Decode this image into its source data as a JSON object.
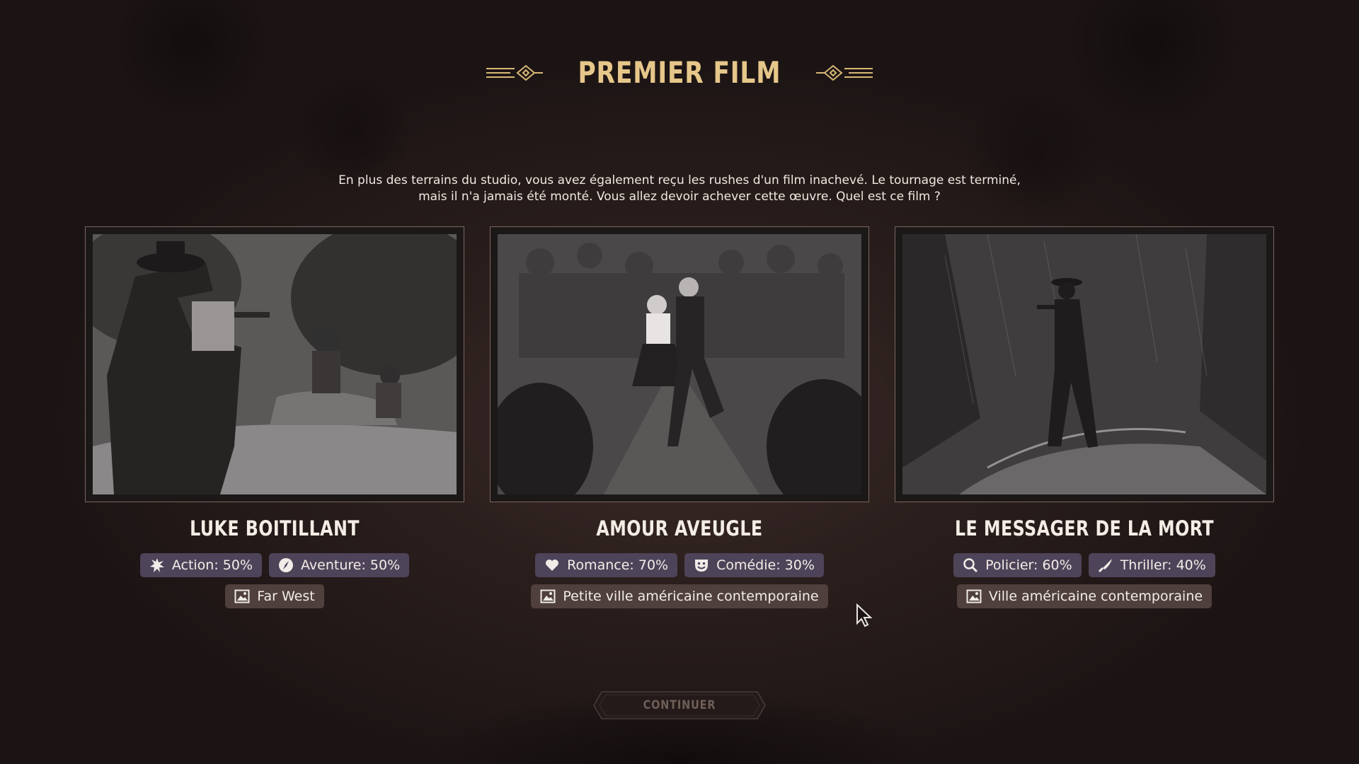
{
  "screen": {
    "title": "PREMIER FILM",
    "intro_line1": "En plus des terrains du studio, vous avez également reçu les rushes d'un film inachevé. Le tournage est terminé,",
    "intro_line2": "mais il n'a jamais été monté. Vous allez devoir achever cette œuvre. Quel est ce film ?"
  },
  "films": [
    {
      "title": "LUKE BOITILLANT",
      "genres": [
        {
          "label": "Action: 50%",
          "icon": "explosion-icon"
        },
        {
          "label": "Aventure: 50%",
          "icon": "compass-icon"
        }
      ],
      "setting": {
        "label": "Far West",
        "icon": "picture-icon"
      }
    },
    {
      "title": "AMOUR AVEUGLE",
      "genres": [
        {
          "label": "Romance: 70%",
          "icon": "heart-icon"
        },
        {
          "label": "Comédie: 30%",
          "icon": "mask-icon"
        }
      ],
      "setting": {
        "label": "Petite ville américaine contemporaine",
        "icon": "picture-icon"
      }
    },
    {
      "title": "LE MESSAGER DE LA MORT",
      "genres": [
        {
          "label": "Policier: 60%",
          "icon": "magnifier-icon"
        },
        {
          "label": "Thriller: 40%",
          "icon": "knife-icon"
        }
      ],
      "setting": {
        "label": "Ville américaine contemporaine",
        "icon": "picture-icon"
      }
    }
  ],
  "continue_label": "CONTINUER",
  "colors": {
    "title_gold": "#e6c78a",
    "genre_chip": "#4e4459",
    "setting_chip": "#4f3f3d",
    "background": "#2b1f1d"
  }
}
